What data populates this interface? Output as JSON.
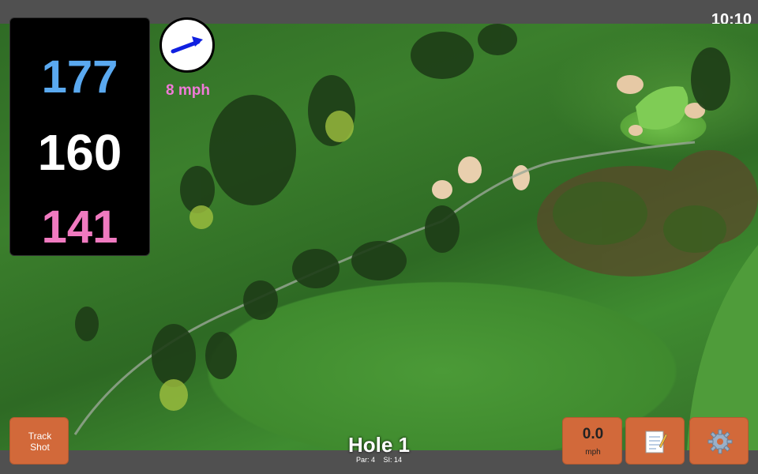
{
  "status": {
    "time": "10:10"
  },
  "yardages": {
    "back": "177",
    "middle": "160",
    "front": "141"
  },
  "wind": {
    "speed_label": "8 mph",
    "direction_icon": "arrow-east-icon"
  },
  "hole": {
    "title": "Hole 1",
    "par_label": "Par: 4",
    "si_label": "SI: 14"
  },
  "buttons": {
    "track_shot_line1": "Track",
    "track_shot_line2": "Shot",
    "speed_value": "0.0",
    "speed_unit": "mph",
    "notes_icon": "notepad-icon",
    "settings_icon": "gear-icon"
  },
  "colors": {
    "back": "#5aa9f0",
    "middle": "#ffffff",
    "front": "#f07ac0",
    "wind": "#f07ad8",
    "button": "#d2693a"
  }
}
